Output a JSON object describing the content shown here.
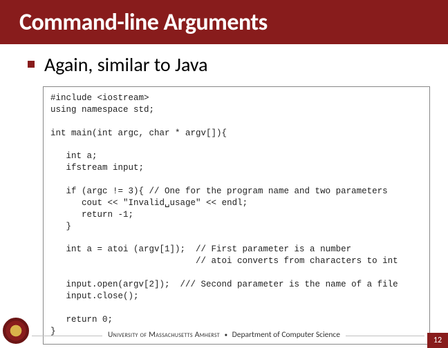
{
  "title": "Command-line Arguments",
  "bullet": "Again, similar to Java",
  "code": "#include <iostream>\nusing namespace std;\n\nint main(int argc, char * argv[]){\n\n   int a;\n   ifstream input;\n\n   if (argc != 3){ // One for the program name and two parameters\n      cout << \"Invalid␣usage\" << endl;\n      return -1;\n   }\n\n   int a = atoi (argv[1]);  // First parameter is a number\n                            // atoi converts from characters to int\n\n   input.open(argv[2]);  /// Second parameter is the name of a file\n   input.close();\n\n   return 0;\n}",
  "footer": {
    "university": "University of Massachusetts Amherst",
    "department": "Department of Computer Science"
  },
  "page_number": "12"
}
